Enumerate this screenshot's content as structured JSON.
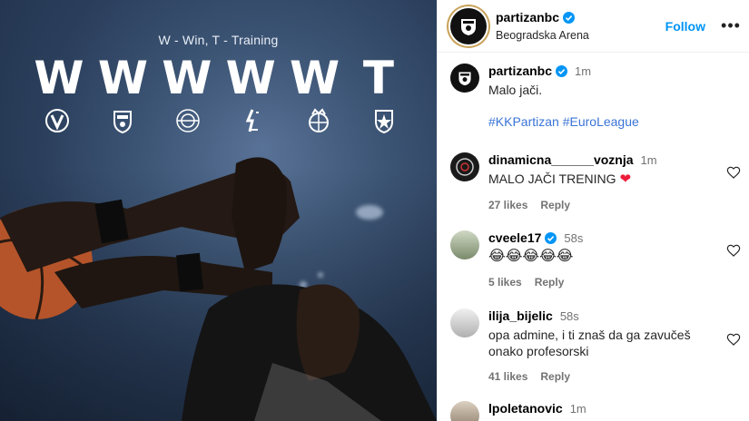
{
  "media": {
    "legend": "W - Win, T - Training",
    "results": [
      "W",
      "W",
      "W",
      "W",
      "W",
      "T"
    ],
    "logos": [
      "virtus-logo",
      "crest-logo",
      "paris-basketball-logo",
      "baskonia-logo",
      "valencia-logo",
      "crvena-zvezda-logo"
    ]
  },
  "post": {
    "username": "partizanbc",
    "location": "Beogradska Arena",
    "follow_label": "Follow",
    "more_label": "•••",
    "caption": {
      "username": "partizanbc",
      "time": "1m",
      "text": "Malo jači.",
      "hashtags": "#KKPartizan #EuroLeague"
    }
  },
  "comments": [
    {
      "username": "dinamicna______voznja",
      "time": "1m",
      "text": "MALO JAČI TRENING",
      "emoji": "❤",
      "likes": "27 likes",
      "reply": "Reply"
    },
    {
      "username": "cveele17",
      "time": "58s",
      "text": "😂😂😂😂😂",
      "likes": "5 likes",
      "reply": "Reply"
    },
    {
      "username": "ilija_bijelic",
      "time": "58s",
      "text": "opa admine, i ti znaš da ga zavučeš onako profesorski",
      "likes": "41 likes",
      "reply": "Reply"
    },
    {
      "username": "lpoletanovic",
      "time": "1m"
    }
  ],
  "colors": {
    "follow": "#0095f6",
    "hashtag": "#3a74d6",
    "verified": "#0095f6",
    "heart": "#ed1c3b"
  }
}
